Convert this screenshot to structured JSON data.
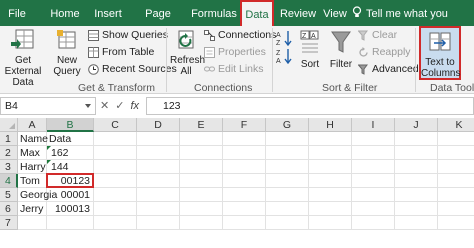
{
  "tabs": [
    {
      "label": "File",
      "active": false
    },
    {
      "label": "Home",
      "active": false
    },
    {
      "label": "Insert",
      "active": false
    },
    {
      "label": "Page Layout",
      "active": false
    },
    {
      "label": "Formulas",
      "active": false
    },
    {
      "label": "Data",
      "active": true
    },
    {
      "label": "Review",
      "active": false
    },
    {
      "label": "View",
      "active": false
    }
  ],
  "tell_me": "Tell me what you want to",
  "ribbon": {
    "get_external_data": "Get External Data",
    "new_query": "New Query",
    "show_queries": "Show Queries",
    "from_table": "From Table",
    "recent_sources": "Recent Sources",
    "get_transform_group": "Get & Transform",
    "refresh_all": "Refresh All",
    "connections": "Connections",
    "properties": "Properties",
    "edit_links": "Edit Links",
    "connections_group": "Connections",
    "sort_az": "A Z",
    "sort_za": "Z A",
    "sort": "Sort",
    "filter": "Filter",
    "clear": "Clear",
    "reapply": "Reapply",
    "advanced": "Advanced",
    "sort_filter_group": "Sort & Filter",
    "text_to_columns": "Text to Columns",
    "data_tools_group": "Data Tool"
  },
  "formula_bar": {
    "name_box": "B4",
    "cancel": "✕",
    "enter": "✓",
    "fx": "fx",
    "value": "123"
  },
  "sheet": {
    "columns": [
      "A",
      "B",
      "C",
      "D",
      "E",
      "F",
      "G",
      "H",
      "I",
      "J",
      "K"
    ],
    "selected_column": "B",
    "rows": [
      "1",
      "2",
      "3",
      "4",
      "5",
      "6",
      "7"
    ],
    "selected_row": "4",
    "cells": [
      [
        "Name",
        "Data"
      ],
      [
        "Max",
        "162"
      ],
      [
        "Harry",
        "144"
      ],
      [
        "Tom",
        "00123"
      ],
      [
        "Georgia",
        "00001"
      ],
      [
        "Jerry",
        "100013"
      ],
      [
        "",
        ""
      ]
    ]
  },
  "colors": {
    "accent_green": "#217346",
    "highlight_red": "#d12a2a"
  }
}
